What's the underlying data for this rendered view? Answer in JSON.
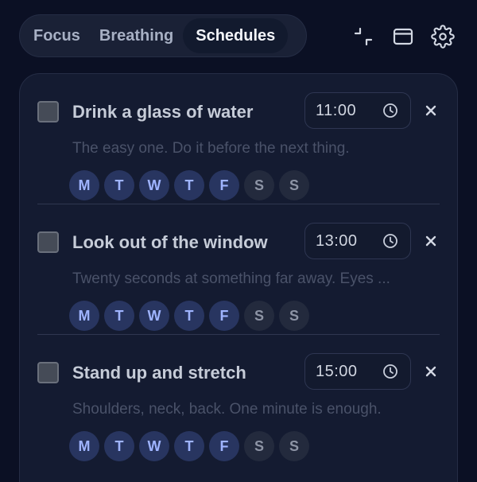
{
  "tabs": [
    {
      "label": "Focus",
      "active": false
    },
    {
      "label": "Breathing",
      "active": false
    },
    {
      "label": "Schedules",
      "active": true
    }
  ],
  "header_icons": [
    "collapse-icon",
    "window-icon",
    "gear-icon"
  ],
  "colors": {
    "background": "#0b1024",
    "panel": "#141b31",
    "day_active_bg": "#283560",
    "day_active_text": "#9fb4ff",
    "day_inactive_bg": "#232a3d",
    "day_inactive_text": "#8d94a5"
  },
  "schedules": [
    {
      "title": "Drink a glass of water",
      "time": "11:00",
      "description": "The easy one. Do it before the next thing.",
      "checked": false,
      "days": [
        {
          "label": "M",
          "active": true
        },
        {
          "label": "T",
          "active": true
        },
        {
          "label": "W",
          "active": true
        },
        {
          "label": "T",
          "active": true
        },
        {
          "label": "F",
          "active": true
        },
        {
          "label": "S",
          "active": false
        },
        {
          "label": "S",
          "active": false
        }
      ]
    },
    {
      "title": "Look out of the window",
      "time": "13:00",
      "description": "Twenty seconds at something far away. Eyes ...",
      "checked": false,
      "days": [
        {
          "label": "M",
          "active": true
        },
        {
          "label": "T",
          "active": true
        },
        {
          "label": "W",
          "active": true
        },
        {
          "label": "T",
          "active": true
        },
        {
          "label": "F",
          "active": true
        },
        {
          "label": "S",
          "active": false
        },
        {
          "label": "S",
          "active": false
        }
      ]
    },
    {
      "title": "Stand up and stretch",
      "time": "15:00",
      "description": "Shoulders, neck, back. One minute is enough.",
      "checked": false,
      "days": [
        {
          "label": "M",
          "active": true
        },
        {
          "label": "T",
          "active": true
        },
        {
          "label": "W",
          "active": true
        },
        {
          "label": "T",
          "active": true
        },
        {
          "label": "F",
          "active": true
        },
        {
          "label": "S",
          "active": false
        },
        {
          "label": "S",
          "active": false
        }
      ]
    }
  ]
}
